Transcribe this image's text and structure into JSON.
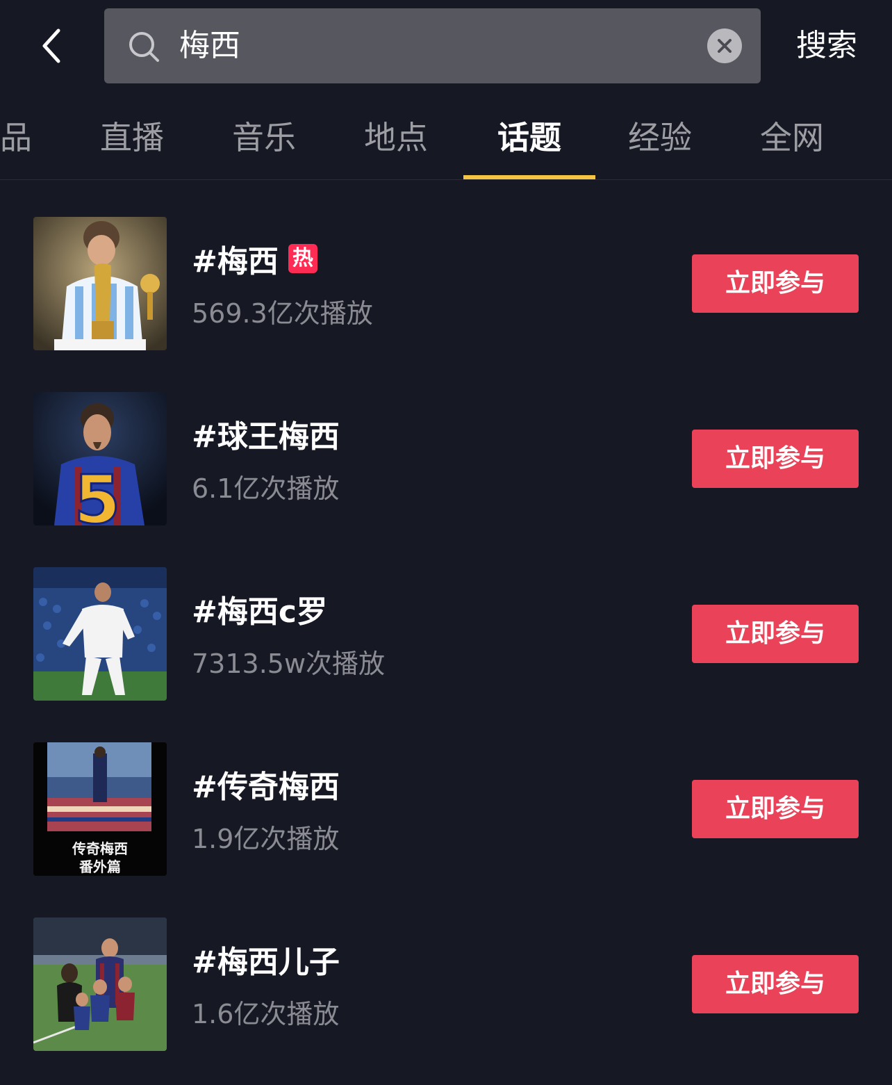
{
  "search": {
    "query": "梅西",
    "submit_label": "搜索"
  },
  "tabs": [
    {
      "label": "品",
      "active": false
    },
    {
      "label": "直播",
      "active": false
    },
    {
      "label": "音乐",
      "active": false
    },
    {
      "label": "地点",
      "active": false
    },
    {
      "label": "话题",
      "active": true
    },
    {
      "label": "经验",
      "active": false
    },
    {
      "label": "全网",
      "active": false
    }
  ],
  "colors": {
    "background": "#161823",
    "accent_underline": "#f6c443",
    "join_button": "#ea4359",
    "hot_badge": "#fe2c55"
  },
  "topics": [
    {
      "title": "#梅西",
      "hot_badge": "热",
      "views": "569.3亿次播放",
      "join_label": "立即参与",
      "thumb_icon": "player-with-trophy-photo"
    },
    {
      "title": "#球王梅西",
      "views": "6.1亿次播放",
      "join_label": "立即参与",
      "thumb_icon": "player-jersey-5-photo"
    },
    {
      "title": "#梅西c罗",
      "views": "7313.5w次播放",
      "join_label": "立即参与",
      "thumb_icon": "player-celebrating-photo"
    },
    {
      "title": "#传奇梅西",
      "views": "1.9亿次播放",
      "join_label": "立即参与",
      "thumb_icon": "stadium-poster",
      "thumb_caption_1": "传奇梅西",
      "thumb_caption_2": "番外篇"
    },
    {
      "title": "#梅西儿子",
      "views": "1.6亿次播放",
      "join_label": "立即参与",
      "thumb_icon": "family-on-pitch-photo"
    }
  ]
}
